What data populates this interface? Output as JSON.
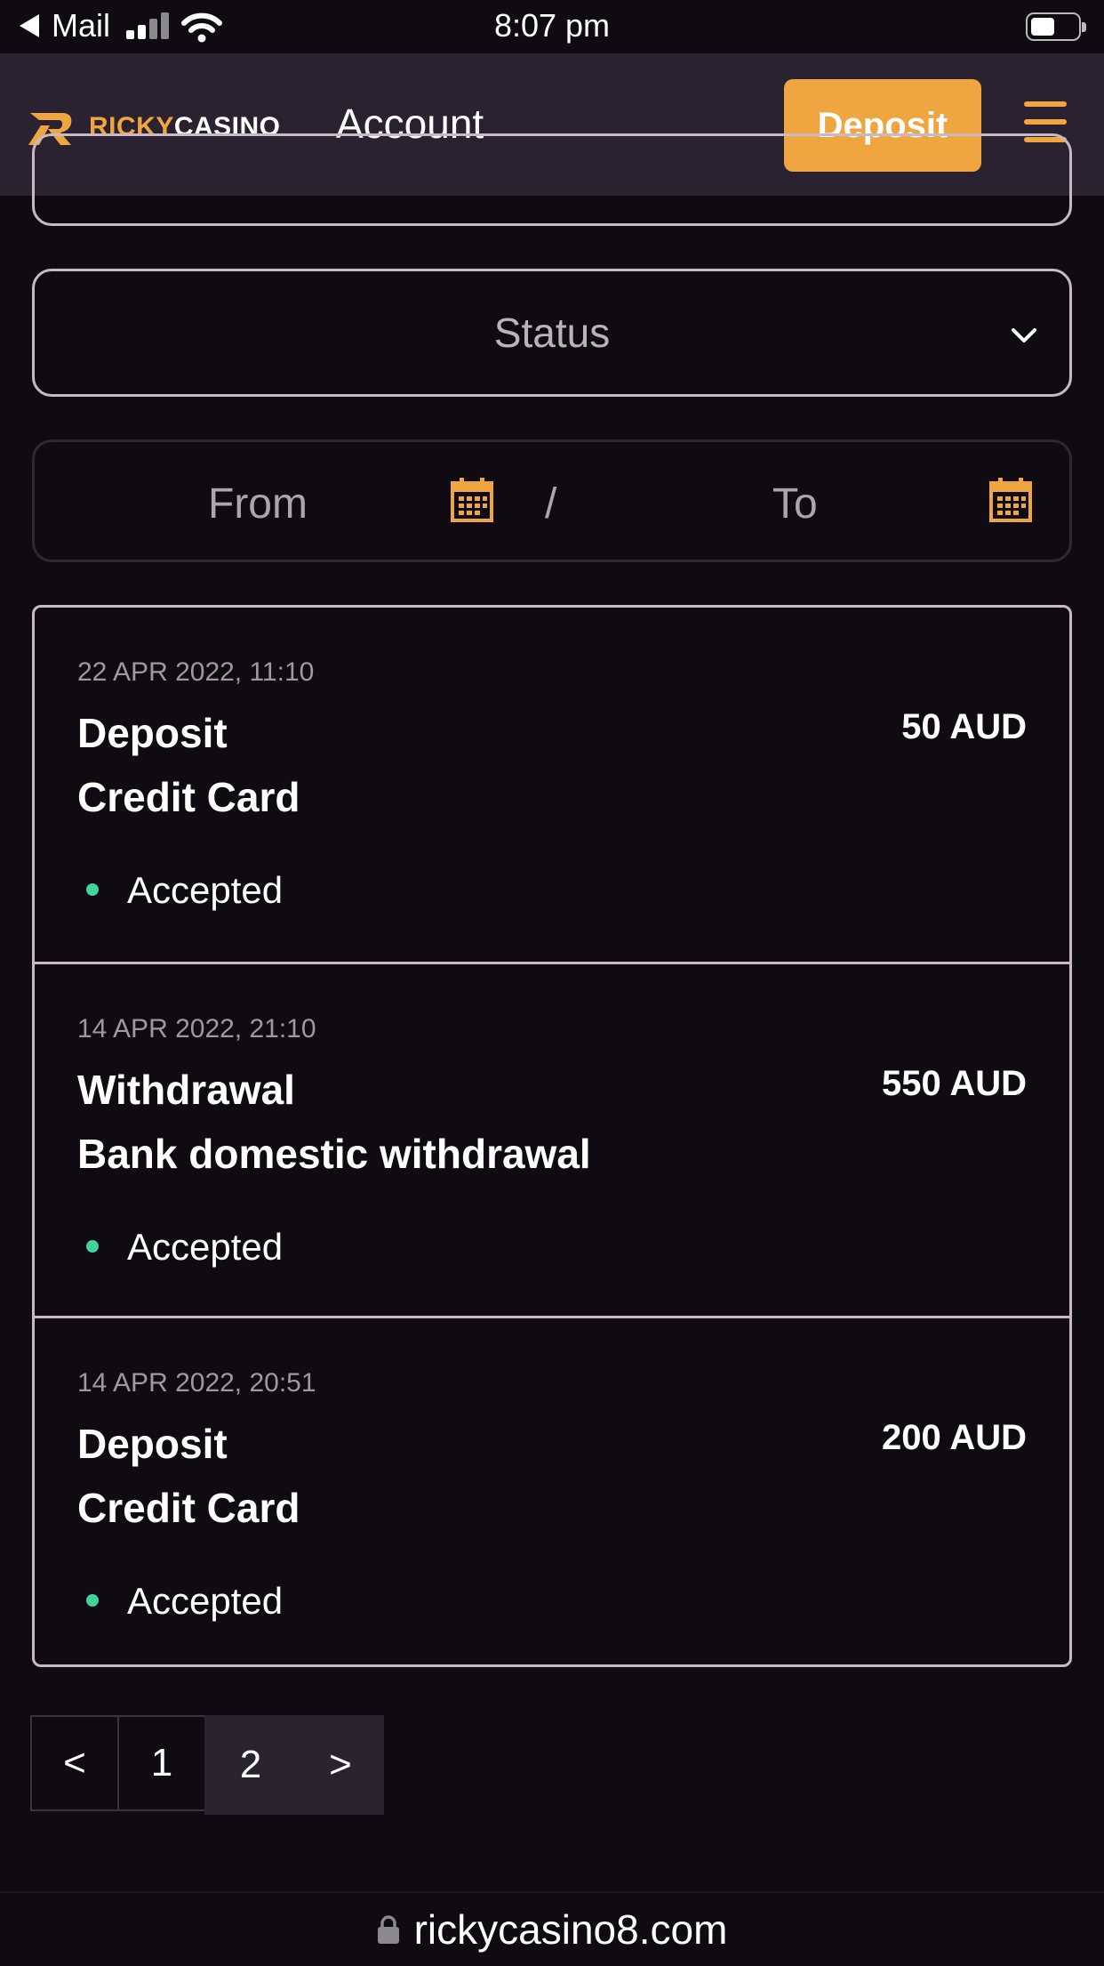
{
  "status_bar": {
    "back_app": "Mail",
    "time": "8:07 pm"
  },
  "header": {
    "logo_part1": "RICKY",
    "logo_part2": "CASINO",
    "title": "Account",
    "deposit_label": "Deposit",
    "accent_color": "#f0a640"
  },
  "filters": {
    "status_placeholder": "Status",
    "from_label": "From",
    "separator": "/",
    "to_label": "To"
  },
  "transactions": [
    {
      "date": "22 APR 2022, 11:10",
      "type": "Deposit",
      "method": "Credit Card",
      "amount": "50 AUD",
      "status": "Accepted"
    },
    {
      "date": "14 APR 2022, 21:10",
      "type": "Withdrawal",
      "method": "Bank domestic withdrawal",
      "amount": "550 AUD",
      "status": "Accepted"
    },
    {
      "date": "14 APR 2022, 20:51",
      "type": "Deposit",
      "method": "Credit Card",
      "amount": "200 AUD",
      "status": "Accepted"
    }
  ],
  "pagination": {
    "prev": "<",
    "pages": [
      "1",
      "2"
    ],
    "current": "2",
    "next": ">"
  },
  "browser": {
    "url": "rickycasino8.com"
  }
}
